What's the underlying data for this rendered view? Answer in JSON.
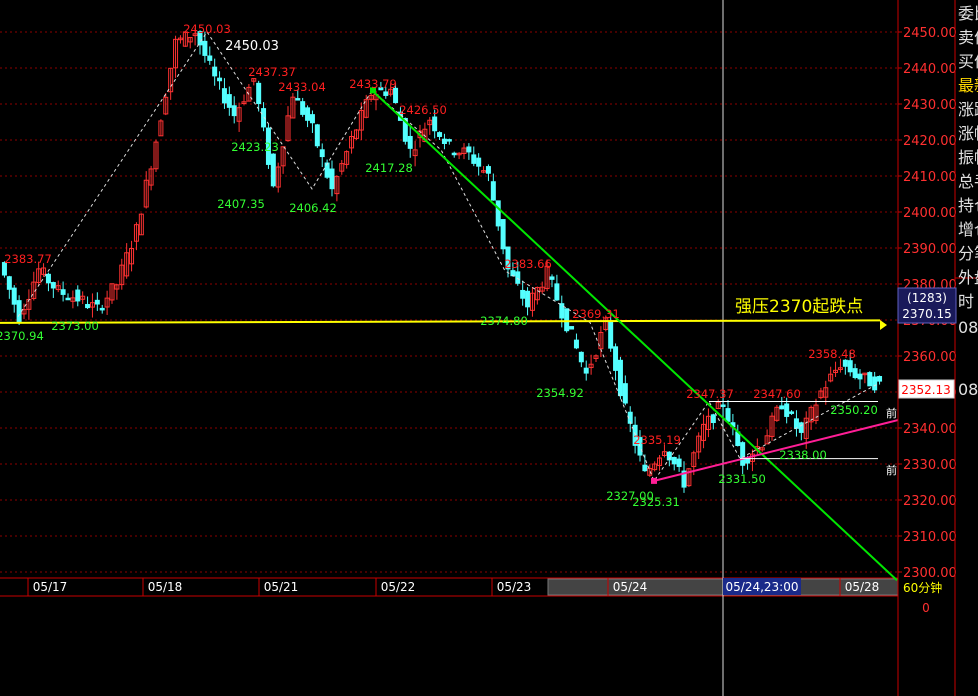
{
  "chart_data": {
    "type": "candlestick",
    "timeframe_label": "60分钟",
    "y_axis": {
      "ylim": [
        2297,
        2460
      ],
      "ticks": [
        "2300.00",
        "2310.00",
        "2320.00",
        "2330.00",
        "2340.00",
        "2350.00",
        "2360.00",
        "2370.00",
        "2380.00",
        "2390.00",
        "2400.00",
        "2410.00",
        "2420.00",
        "2430.00",
        "2440.00",
        "2450.00"
      ]
    },
    "x_axis": {
      "dates": [
        "05/17",
        "05/18",
        "05/21",
        "05/22",
        "05/23",
        "05/24",
        "05/28"
      ],
      "crosshair_date": "05/24,23:00"
    },
    "price_tags": {
      "volume": "(1283)",
      "price_level": "2370.15",
      "last": "2352.13",
      "bottom": "0"
    },
    "swing_points": [
      {
        "label": "2383.77",
        "value": 2383.77,
        "dir": "high"
      },
      {
        "label": "2370.94",
        "value": 2370.94,
        "dir": "low"
      },
      {
        "label": "2373.00",
        "value": 2373.0,
        "dir": "low"
      },
      {
        "label": "2450.03",
        "value": 2450.03,
        "dir": "high"
      },
      {
        "label": "2450.03",
        "value": 2450.03,
        "dir": "high"
      },
      {
        "label": "2437.37",
        "value": 2437.37,
        "dir": "high"
      },
      {
        "label": "2433.04",
        "value": 2433.04,
        "dir": "high"
      },
      {
        "label": "2423.23",
        "value": 2423.23,
        "dir": "low"
      },
      {
        "label": "2407.35",
        "value": 2407.35,
        "dir": "low"
      },
      {
        "label": "2406.42",
        "value": 2406.42,
        "dir": "low"
      },
      {
        "label": "2433.79",
        "value": 2433.79,
        "dir": "high"
      },
      {
        "label": "2426.50",
        "value": 2426.5,
        "dir": "high"
      },
      {
        "label": "2417.28",
        "value": 2417.28,
        "dir": "low"
      },
      {
        "label": "2383.66",
        "value": 2383.66,
        "dir": "high"
      },
      {
        "label": "2374.80",
        "value": 2374.8,
        "dir": "low"
      },
      {
        "label": "2369.31",
        "value": 2369.31,
        "dir": "high"
      },
      {
        "label": "2354.92",
        "value": 2354.92,
        "dir": "low"
      },
      {
        "label": "2335.19",
        "value": 2335.19,
        "dir": "high"
      },
      {
        "label": "2327.00",
        "value": 2327.0,
        "dir": "low"
      },
      {
        "label": "2325.31",
        "value": 2325.31,
        "dir": "low"
      },
      {
        "label": "2347.37",
        "value": 2347.37,
        "dir": "high"
      },
      {
        "label": "2347.60",
        "value": 2347.6,
        "dir": "high"
      },
      {
        "label": "2331.50",
        "value": 2331.5,
        "dir": "low"
      },
      {
        "label": "2338.00",
        "value": 2338.0,
        "dir": "low"
      },
      {
        "label": "2358.48",
        "value": 2358.48,
        "dir": "high"
      },
      {
        "label": "2350.20",
        "value": 2350.2,
        "dir": "low"
      }
    ],
    "price_path": [
      2386,
      2371,
      2384,
      2378,
      2376,
      2373,
      2380,
      2395,
      2420,
      2447,
      2450,
      2437,
      2427,
      2437,
      2407,
      2433,
      2423,
      2406,
      2420,
      2433,
      2434,
      2417,
      2426,
      2418,
      2416,
      2410,
      2384,
      2374,
      2383,
      2369,
      2355,
      2369,
      2345,
      2327,
      2335,
      2325,
      2340,
      2347,
      2331,
      2336,
      2347,
      2338,
      2350,
      2358,
      2354,
      2352
    ],
    "annotation": "强压2370起跌点",
    "right_panel_labels": [
      "委比",
      "卖价",
      "买价",
      "最新",
      "涨跌",
      "涨幅",
      "振幅",
      "总手",
      "持仓",
      "增仓",
      "分笔",
      "外盘"
    ],
    "right_panel_lower": [
      "时",
      "08",
      "08"
    ],
    "side_marker": "前",
    "colors": {
      "up": "#ff3232",
      "down": "#54ffff",
      "grid": "#8b0000",
      "axis": "#c80000",
      "resistance": "#ffff00",
      "trend_down": "#00e600",
      "trend_up": "#ff1e96"
    }
  }
}
